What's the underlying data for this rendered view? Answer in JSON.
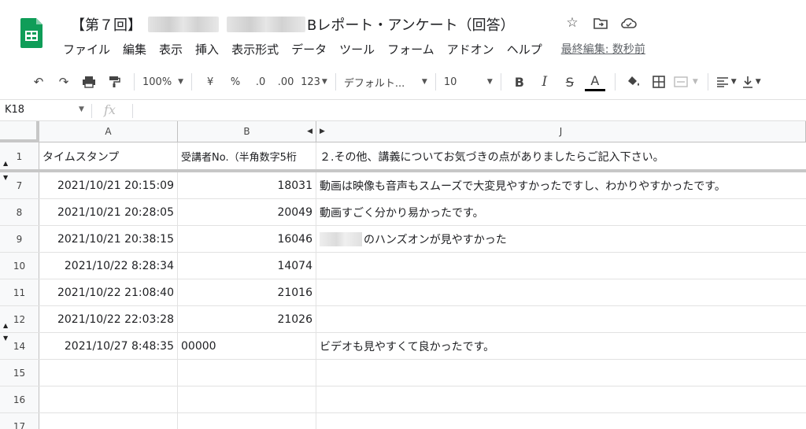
{
  "doc": {
    "title_prefix": "【第７回】",
    "title_suffix": "Bレポート・アンケート（回答）",
    "icons": [
      "star-icon",
      "move-to-folder-icon",
      "cloud-status-icon"
    ]
  },
  "menu": {
    "items": [
      "ファイル",
      "編集",
      "表示",
      "挿入",
      "表示形式",
      "データ",
      "ツール",
      "フォーム",
      "アドオン",
      "ヘルプ"
    ],
    "last_edit": "最終編集: 数秒前"
  },
  "toolbar": {
    "undo": "↶",
    "redo": "↷",
    "print": "🖶",
    "paint_format": "🖌",
    "zoom": "100%",
    "currency": "¥",
    "percent": "%",
    "decimal_decrease": ".0",
    "decimal_increase": ".00",
    "more_formats": "123",
    "font": "デフォルト...",
    "font_size": "10",
    "bold": "B",
    "italic": "I",
    "strike": "S",
    "text_color": "A",
    "fill_color": "◈",
    "borders": "⊞",
    "merge": "⊟",
    "align": "≡",
    "valign": "⊥"
  },
  "formula_bar": {
    "cell_ref": "K18",
    "fx": "fx",
    "value": ""
  },
  "columns": [
    {
      "key": "A",
      "label": "A"
    },
    {
      "key": "B",
      "label": "B"
    },
    {
      "key": "J",
      "label": "J"
    }
  ],
  "header_row": {
    "number": "1",
    "A": "タイムスタンプ",
    "B": "受講者No.（半角数字5桁",
    "J": "２.その他、講義についてお気づきの点がありましたらご記入下さい。"
  },
  "rows": [
    {
      "number": "7",
      "A": "2021/10/21 20:15:09",
      "B": "18031",
      "J": "動画は映像も音声もスムーズで大変見やすかったですし、わかりやすかったです。"
    },
    {
      "number": "8",
      "A": "2021/10/21 20:28:05",
      "B": "20049",
      "J": "動画すごく分かり易かったです。"
    },
    {
      "number": "9",
      "A": "2021/10/21 20:38:15",
      "B": "16046",
      "J": "のハンズオンが見やすかった"
    },
    {
      "number": "10",
      "A": "2021/10/22 8:28:34",
      "B": "14074",
      "J": ""
    },
    {
      "number": "11",
      "A": "2021/10/22 21:08:40",
      "B": "21016",
      "J": ""
    },
    {
      "number": "12",
      "A": "2021/10/22 22:03:28",
      "B": "21026",
      "J": ""
    },
    {
      "number": "14",
      "A": "2021/10/27 8:48:35",
      "B": "00000",
      "J": "ビデオも見やすくて良かったです。"
    },
    {
      "number": "15",
      "A": "",
      "B": "",
      "J": ""
    },
    {
      "number": "16",
      "A": "",
      "B": "",
      "J": ""
    },
    {
      "number": "17",
      "A": "",
      "B": "",
      "J": ""
    }
  ],
  "colors": {
    "sheets_green": "#0f9d58",
    "header_bg": "#f8f9fa",
    "freeze_line": "#c7c7c7"
  }
}
